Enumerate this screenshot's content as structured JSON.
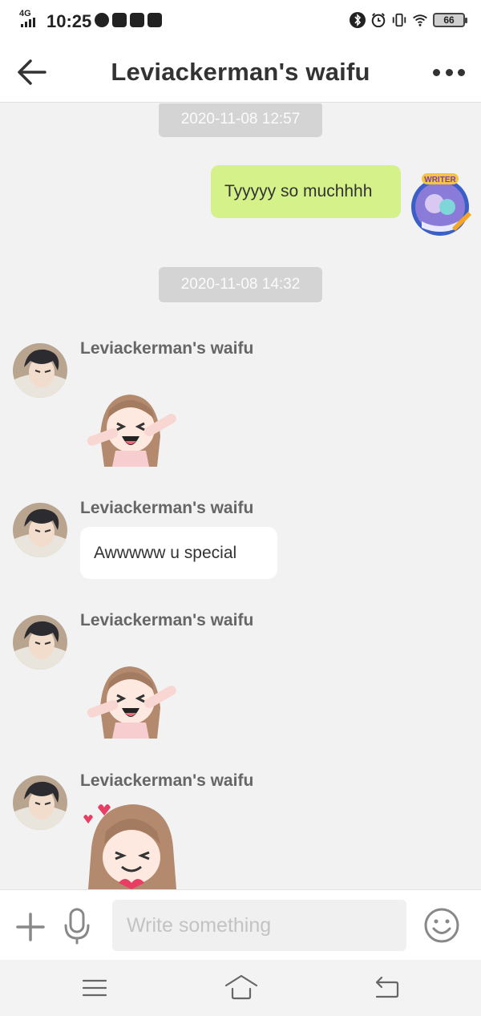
{
  "status_bar": {
    "network": "4G",
    "time": "10:25",
    "battery": "66",
    "left_icons": [
      "compass-icon",
      "mail-icon",
      "youtube-icon",
      "message-icon"
    ],
    "right_icons": [
      "bluetooth-icon",
      "alarm-icon",
      "vibrate-icon",
      "wifi-icon",
      "battery-icon"
    ]
  },
  "header": {
    "title": "Leviackerman's waifu",
    "back_icon": "arrow-left-icon",
    "more_icon": "more-dots-icon"
  },
  "chat": {
    "messages": [
      {
        "type": "timestamp",
        "text": "2020-11-08 12:57"
      },
      {
        "type": "text",
        "from": "me",
        "text": "Tyyyyy so muchhhh",
        "avatar_badge": "WRITER"
      },
      {
        "type": "timestamp",
        "text": "2020-11-08 14:32"
      },
      {
        "type": "sticker",
        "from": "them",
        "sender": "Leviackerman's waifu",
        "sticker": "excited-girl-sticker"
      },
      {
        "type": "text",
        "from": "them",
        "sender": "Leviackerman's waifu",
        "text": "Awwwww u special"
      },
      {
        "type": "sticker",
        "from": "them",
        "sender": "Leviackerman's waifu",
        "sticker": "excited-girl-sticker"
      },
      {
        "type": "sticker",
        "from": "them",
        "sender": "Leviackerman's waifu",
        "sticker": "heart-girl-sticker"
      }
    ]
  },
  "composer": {
    "placeholder": "Write something",
    "plus_icon": "plus-icon",
    "mic_icon": "microphone-icon",
    "emoji_icon": "emoji-icon"
  },
  "nav_bar": {
    "icons": [
      "menu-icon",
      "home-icon",
      "back-icon"
    ]
  },
  "colors": {
    "my_bubble": "#d5f28a",
    "their_bubble": "#ffffff",
    "chat_background": "#f2f2f2",
    "timestamp_pill": "#d4d4d4",
    "sender_name": "#666666",
    "writer_badge": "#f6c343"
  }
}
